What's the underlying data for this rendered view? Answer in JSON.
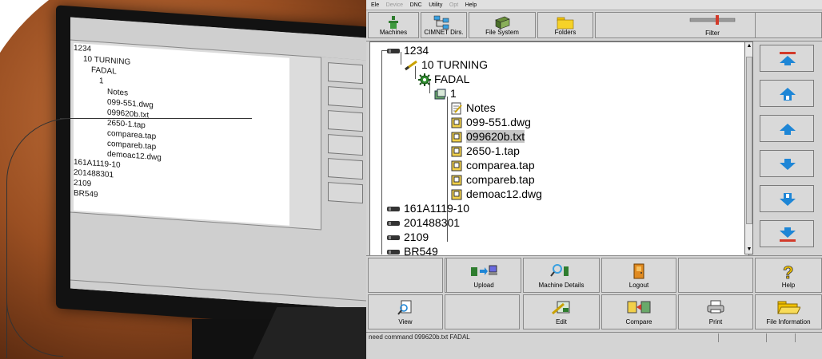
{
  "menu": [
    "Ele",
    "Device",
    "DNC",
    "Utility",
    "Opt",
    "Help"
  ],
  "toolbar": {
    "machines": "Machines",
    "cimnet_dirs": "CIMNET Dirs.",
    "file_system": "File System",
    "folders": "Folders",
    "filter": "Filter"
  },
  "tree": {
    "root1": "1234",
    "turning": "10 TURNING",
    "fadal": "FADAL",
    "one": "1",
    "notes": "Notes",
    "files": [
      "099-551.dwg",
      "099620b.txt",
      "2650-1.tap",
      "comparea.tap",
      "compareb.tap",
      "demoac12.dwg"
    ],
    "selected_file": "099620b.txt",
    "others": [
      "161A1119-10",
      "201488301",
      "2109",
      "BR549"
    ]
  },
  "actions_row1": {
    "upload": "Upload",
    "machine_details": "Machine Details",
    "logout": "Logout",
    "help": "Help"
  },
  "actions_row2": {
    "view": "View",
    "edit": "Edit",
    "compare": "Compare",
    "print": "Print",
    "file_information": "File Information"
  },
  "status": {
    "text": "need command 099620b.txt FADAL"
  },
  "colors": {
    "nav_arrow_blue": "#1e86d6",
    "nav_arrow_red": "#d23a2a",
    "folder_yellow": "#f2c200",
    "machine_green": "#2f7d2f"
  },
  "icons": {
    "nav": [
      "top-arrow-icon",
      "page-up-icon",
      "up-arrow-icon",
      "down-arrow-icon",
      "page-down-icon",
      "bottom-arrow-icon"
    ]
  }
}
